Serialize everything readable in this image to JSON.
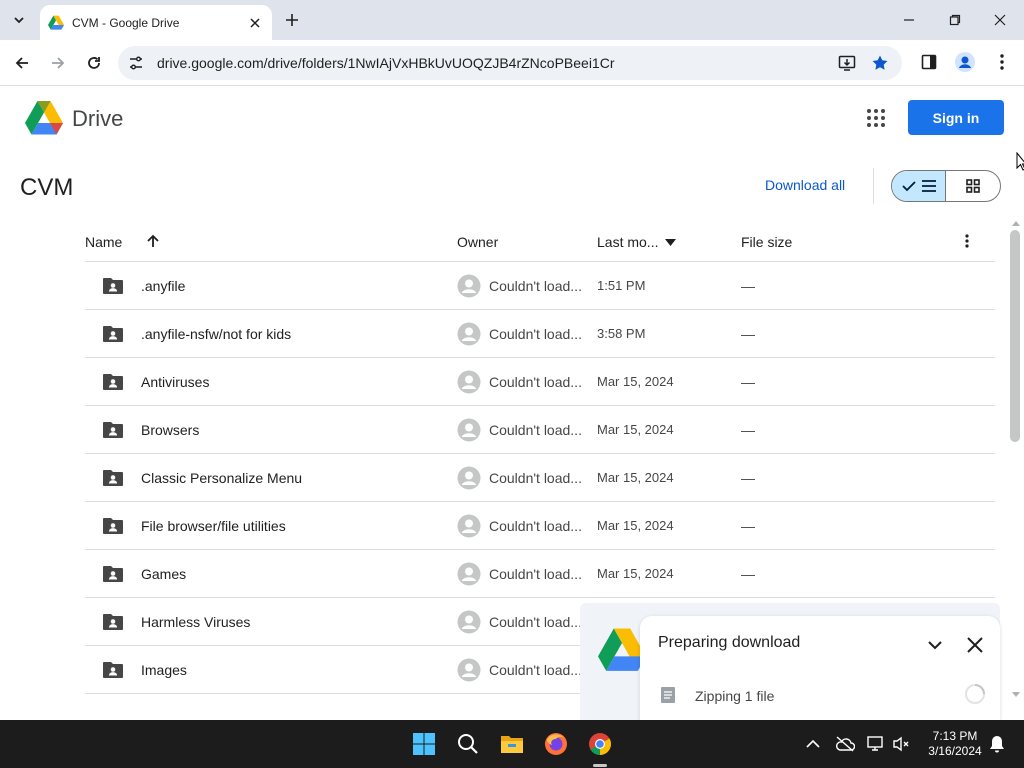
{
  "browser": {
    "tab_title": "CVM - Google Drive",
    "url": "drive.google.com/drive/folders/1NwIAjVxHBkUvUOQZJB4rZNcoPBeei1Cr"
  },
  "drive": {
    "app_name": "Drive",
    "sign_in_label": "Sign in",
    "folder_title": "CVM",
    "download_all_label": "Download all"
  },
  "table": {
    "columns": {
      "name": "Name",
      "owner": "Owner",
      "modified": "Last mo...",
      "size": "File size"
    },
    "rows": [
      {
        "name": ".anyfile",
        "owner": "Couldn't load...",
        "modified": "1:51 PM",
        "size": "—"
      },
      {
        "name": ".anyfile-nsfw/not for kids",
        "owner": "Couldn't load...",
        "modified": "3:58 PM",
        "size": "—"
      },
      {
        "name": "Antiviruses",
        "owner": "Couldn't load...",
        "modified": "Mar 15, 2024",
        "size": "—"
      },
      {
        "name": "Browsers",
        "owner": "Couldn't load...",
        "modified": "Mar 15, 2024",
        "size": "—"
      },
      {
        "name": "Classic Personalize Menu",
        "owner": "Couldn't load...",
        "modified": "Mar 15, 2024",
        "size": "—"
      },
      {
        "name": "File browser/file utilities",
        "owner": "Couldn't load...",
        "modified": "Mar 15, 2024",
        "size": "—"
      },
      {
        "name": "Games",
        "owner": "Couldn't load...",
        "modified": "Mar 15, 2024",
        "size": "—"
      },
      {
        "name": "Harmless Viruses",
        "owner": "Couldn't load...",
        "modified": "",
        "size": ""
      },
      {
        "name": "Images",
        "owner": "Couldn't load...",
        "modified": "",
        "size": ""
      }
    ]
  },
  "download_panel": {
    "title": "Preparing download",
    "status": "Zipping 1 file"
  },
  "taskbar": {
    "time": "7:13 PM",
    "date": "3/16/2024"
  },
  "colors": {
    "accent": "#1a73e8",
    "link": "#0b57d0",
    "toggle_active": "#c2e7ff",
    "tab_strip": "#dfe3eb",
    "taskbar": "#1c1c1c"
  }
}
